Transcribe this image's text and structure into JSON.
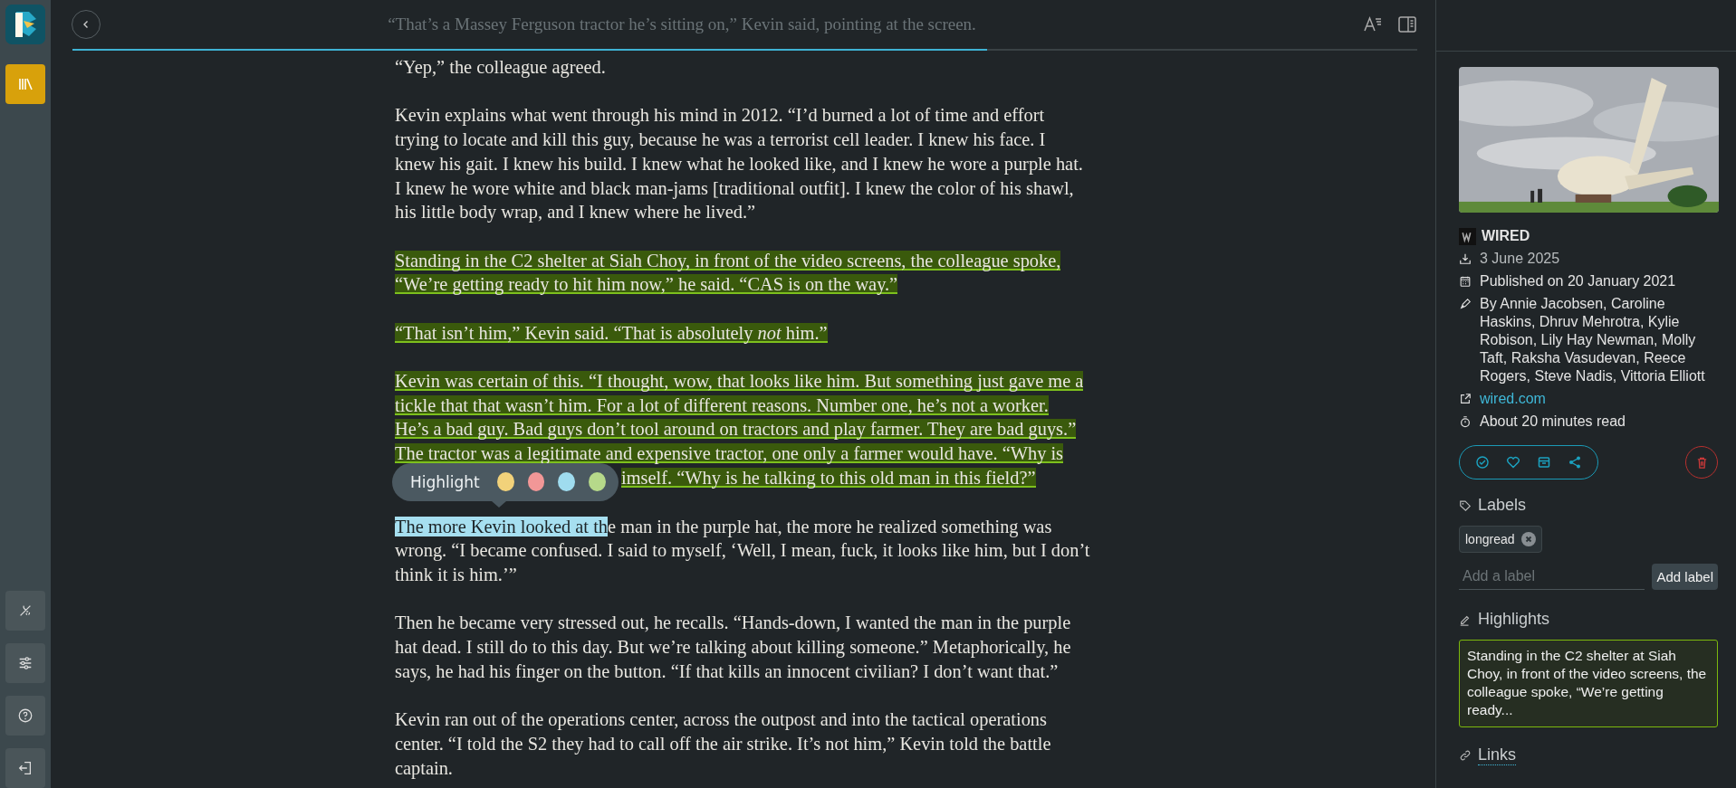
{
  "sidebar": {
    "nav": [
      {
        "selected": true
      }
    ]
  },
  "top_bar": {
    "title": "“That’s a Massey Ferguson tractor he’s sitting on,” Kevin said, pointing at the screen.",
    "progress": {
      "level": 0.68
    }
  },
  "article": {
    "paragraphs": [
      {
        "highlighted": false,
        "lines": [
          [
            {
              "text": "“Yep,” the colleague agreed."
            }
          ]
        ]
      },
      {
        "highlighted": false,
        "lines": [
          [
            {
              "text": "Kevin explains what went through his mind in 2012. “I’d burned a lot of time and effort"
            }
          ],
          [
            {
              "text": "trying to locate and kill this guy, because he was a terrorist cell leader. I knew his face. I"
            }
          ],
          [
            {
              "text": "knew his gait. I knew his build. I knew what he looked like, and I knew he wore a purple hat."
            }
          ],
          [
            {
              "text": "I knew he wore white and black man-jams [traditional outfit]. I knew the color of his shawl,"
            }
          ],
          [
            {
              "text": "his little body wrap, and I knew where he lived.”"
            }
          ]
        ]
      },
      {
        "highlighted": true,
        "lines": [
          [
            {
              "text": "Standing in the C2 shelter at Siah Choy, in front of the video screens, the colleague spoke,"
            }
          ],
          [
            {
              "text": "“We’re getting ready to hit him now,” he said. “CAS is on the way.”"
            }
          ]
        ]
      },
      {
        "highlighted": true,
        "lines": [
          [
            {
              "text": "“That isn’t him,” Kevin said. “That is absolutely *not* him.”"
            }
          ]
        ]
      },
      {
        "highlighted": true,
        "lines": [
          [
            {
              "text": "Kevin was certain of this. “I thought, wow, that looks like him. But something just gave me a"
            }
          ],
          [
            {
              "text": "tickle that that wasn’t him. For a lot of different reasons. Number one, he’s not a worker."
            }
          ],
          [
            {
              "text": "He’s a bad guy. Bad guys don’t tool around on tractors and play farmer. They are bad guys.”"
            }
          ],
          [
            {
              "text": "The tractor was a legitimate and expensive tractor, one only a farmer would have. “Why is"
            }
          ],
          [
            {
              "text": "imself. “Why is he talking to this old man in this field?”"
            }
          ]
        ],
        "popup": {
          "label": "Highlight",
          "colors": [
            {
              "color": "#f2d27a"
            },
            {
              "color": "#f29797"
            },
            {
              "color": "#9fdcef"
            },
            {
              "color": "#b6d98a"
            }
          ]
        }
      },
      {
        "highlighted": false,
        "lines": [
          [
            {
              "text": "The more Kevin looked at th",
              "selected": true
            },
            {
              "text": "e man in the purple hat, the more he realized something was",
              "selected": false
            }
          ],
          [
            {
              "text": "wrong. “I became confused. I said to myself, ‘Well, I mean, fuck, it looks like him, but I don’t"
            }
          ],
          [
            {
              "text": "think it is him.’”"
            }
          ]
        ]
      },
      {
        "highlighted": false,
        "lines": [
          [
            {
              "text": "Then he became very stressed out, he recalls. “Hands-down, I wanted the man in the purple"
            }
          ],
          [
            {
              "text": "hat dead. I still do to this day. But we’re talking about killing someone.” Metaphorically, he"
            }
          ],
          [
            {
              "text": "says, he had his finger on the button. “If that kills an innocent civilian? I don’t want that.”"
            }
          ]
        ]
      },
      {
        "highlighted": false,
        "lines": [
          [
            {
              "text": "Kevin ran out of the operations center, across the outpost and into the tactical operations"
            }
          ],
          [
            {
              "text": "center. “I told the S2 they had to call off the air strike. It’s not him,” Kevin told the battle"
            }
          ],
          [
            {
              "text": "captain."
            }
          ]
        ]
      }
    ]
  },
  "details": {
    "source": "WIRED",
    "saved": "3 June 2025",
    "published": "Published on 20 January 2021",
    "authors": "By Annie Jacobsen, Caroline Haskins, Dhruv Mehrotra, Kylie Robison, Lily Hay Newman, Molly Taft, Raksha Vasudevan, Reece Rogers, Steve Nadis, Vittoria Elliott",
    "link": "wired.com",
    "reading_time": "About 20 minutes read",
    "labels_title": "Labels",
    "labels": [
      "longread"
    ],
    "label_input": {
      "placeholder": "Add a label"
    },
    "add_label_button": "Add label",
    "highlights_title": "Highlights",
    "highlights": [
      "Standing in the C2 shelter at Siah Choy, in front of the video screens, the colleague spoke, “We’re getting ready..."
    ],
    "links_title": "Links"
  }
}
